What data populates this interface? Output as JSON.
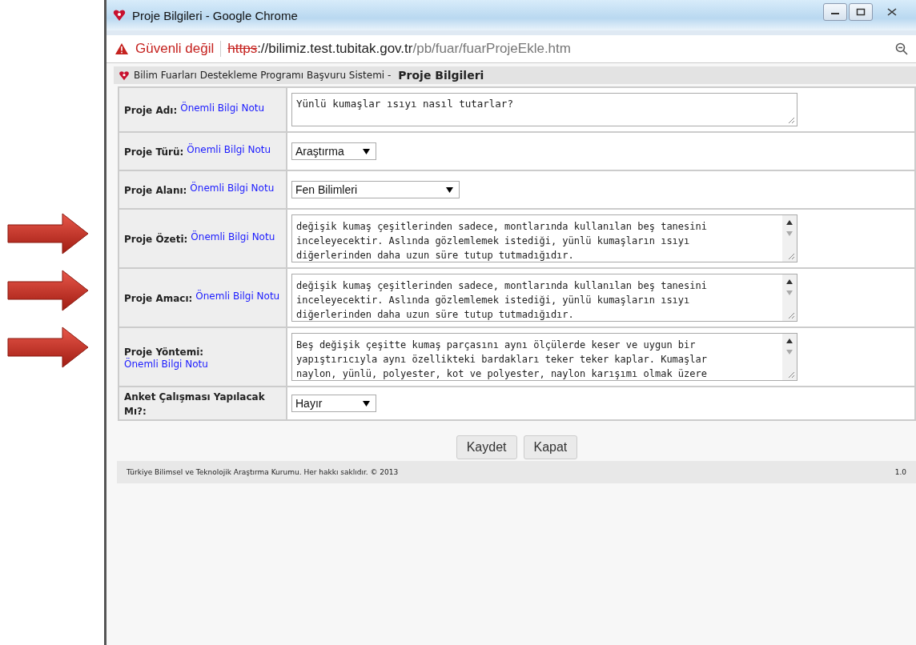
{
  "window": {
    "title": "Proje Bilgileri - Google Chrome"
  },
  "address_bar": {
    "security": "Güvenli değil",
    "scheme": "https",
    "host": "://bilimiz.test.tubitak.gov.tr",
    "path": "/pb/fuar/fuarProjeEkle.htm"
  },
  "page_header": {
    "system": "Bilim Fuarları Destekleme Programı Başvuru Sistemi -",
    "title": "Proje Bilgileri"
  },
  "form": [
    {
      "kind": "input",
      "label": "Proje Adı:",
      "note": "Önemli Bilgi Notu",
      "value": [
        "Yünlü kumaşlar ısıyı nasıl tutarlar?"
      ],
      "arrow": false
    },
    {
      "kind": "select",
      "label": "Proje Türü:",
      "note": "Önemli Bilgi Notu",
      "value": [
        "Araştırma"
      ],
      "arrow": false
    },
    {
      "kind": "select",
      "label": "Proje Alanı:",
      "note": "Önemli Bilgi Notu",
      "value": [
        "Fen Bilimleri"
      ],
      "arrow": false
    },
    {
      "kind": "textarea",
      "label": "Proje Özeti:",
      "note": "Önemli Bilgi Notu",
      "value": [
        "değişik kumaş çeşitlerinden sadece, montlarında kullanılan beş tanesini",
        "inceleyecektir. Aslında gözlemlemek istediği, yünlü kumaşların ısıyı",
        "diğerlerinden daha uzun süre tutup tutmadığıdır."
      ],
      "arrow": true
    },
    {
      "kind": "textarea",
      "label": "Proje Amacı:",
      "note": "Önemli Bilgi Notu",
      "value": [
        "değişik kumaş çeşitlerinden sadece, montlarında kullanılan beş tanesini",
        "inceleyecektir. Aslında gözlemlemek istediği, yünlü kumaşların ısıyı",
        "diğerlerinden daha uzun süre tutup tutmadığıdır."
      ],
      "arrow": true
    },
    {
      "kind": "textarea",
      "label": "Proje Yöntemi:",
      "note": "Önemli Bilgi Notu",
      "value": [
        "Beş değişik çeşitte kumaş parçasını aynı ölçülerde keser ve uygun bir",
        "yapıştırıcıyla aynı özellikteki bardakları teker teker kaplar. Kumaşlar",
        "naylon, yünlü, polyester, kot ve polyester, naylon karışımı olmak üzere"
      ],
      "arrow": true
    },
    {
      "kind": "select_small",
      "label": "Anket Çalışması Yapılacak Mı?:",
      "value": [
        "Hayır"
      ],
      "arrow": false
    }
  ],
  "buttons": [
    "Kaydet",
    "Kapat"
  ],
  "footer": {
    "copyright": "Türkiye Bilimsel ve Teknolojik Araştırma Kurumu. Her hakkı saklıdır. © 2013",
    "version": "1.0"
  }
}
